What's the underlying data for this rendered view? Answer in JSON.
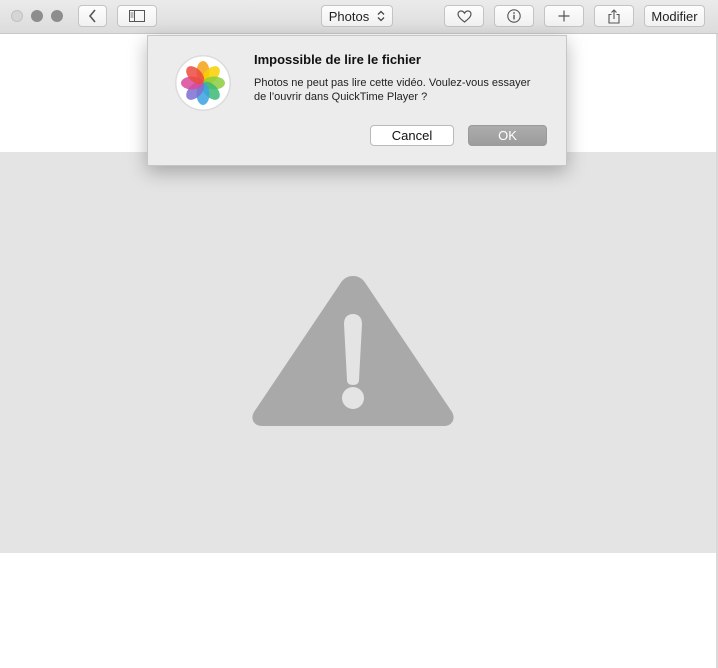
{
  "toolbar": {
    "app_selector_label": "Photos",
    "edit_label": "Modifier",
    "icons": [
      "back-icon",
      "sidebar-icon",
      "heart-icon",
      "info-icon",
      "plus-icon",
      "share-icon",
      "chevron-updown-icon"
    ]
  },
  "dialog": {
    "title": "Impossible de lire le fichier",
    "message": "Photos ne peut pas lire cette vidéo. Voulez-vous essayer de l’ouvrir dans QuickTime Player ?",
    "cancel_label": "Cancel",
    "ok_label": "OK",
    "icon": "photos-app-icon"
  },
  "content": {
    "placeholder_icon": "warning-icon",
    "placeholder_background": "#e4e4e4",
    "warning_color": "#a9a9a9"
  }
}
